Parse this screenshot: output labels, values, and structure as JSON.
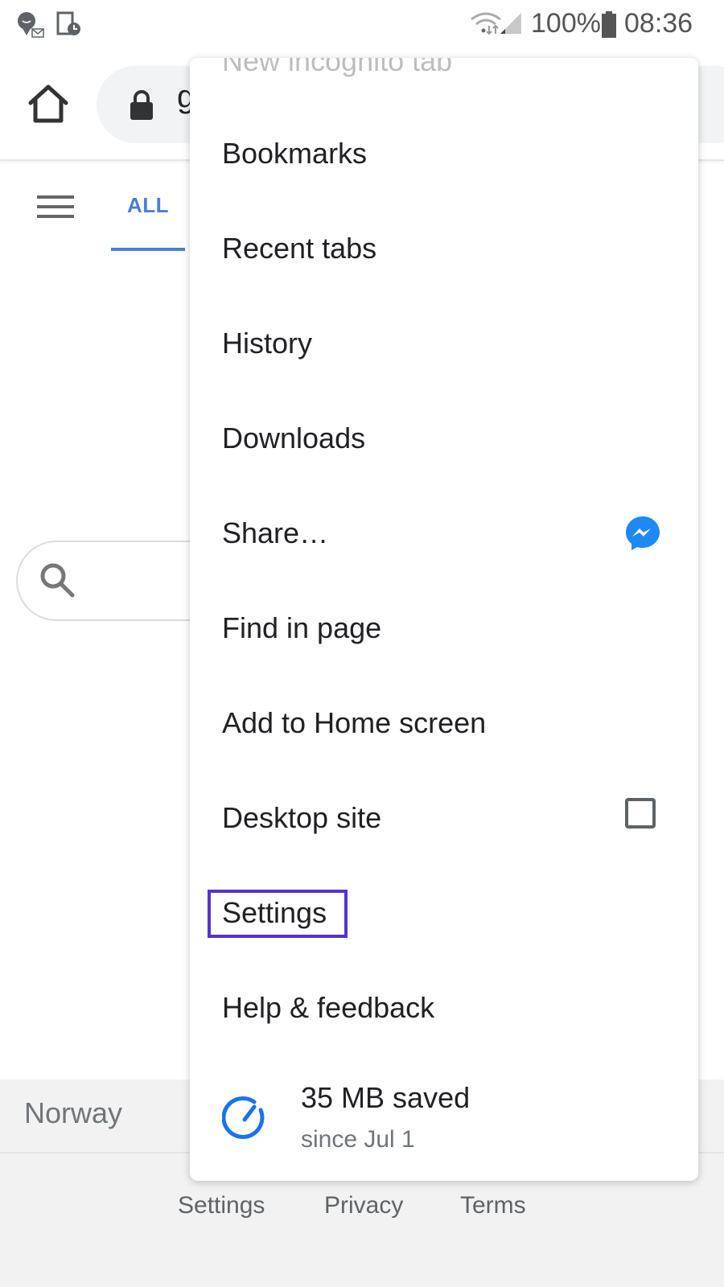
{
  "status_bar": {
    "battery": "100%",
    "time": "08:36",
    "icons": [
      "messenger-notification-icon",
      "screen-timer-icon",
      "wifi-icon",
      "signal-icon",
      "battery-icon"
    ]
  },
  "toolbar": {
    "url_partial": "g",
    "icons": [
      "home-icon",
      "lock-icon"
    ]
  },
  "page": {
    "tabs": [
      {
        "label": "ALL",
        "active": true
      }
    ],
    "country": "Norway",
    "footer_links": [
      "Settings",
      "Privacy",
      "Terms"
    ],
    "accent_color": "#4a7fd8"
  },
  "menu": {
    "partial_top_item": "New incognito tab",
    "items": [
      {
        "label": "Bookmarks"
      },
      {
        "label": "Recent tabs"
      },
      {
        "label": "History"
      },
      {
        "label": "Downloads"
      },
      {
        "label": "Share…",
        "icon": "messenger-icon"
      },
      {
        "label": "Find in page"
      },
      {
        "label": "Add to Home screen"
      },
      {
        "label": "Desktop site",
        "checked": false
      },
      {
        "label": "Settings",
        "highlighted": true
      },
      {
        "label": "Help & feedback"
      }
    ],
    "data_saver": {
      "title": "35 MB saved",
      "subtitle": "since Jul 1"
    },
    "highlight_color": "#5533d0"
  }
}
